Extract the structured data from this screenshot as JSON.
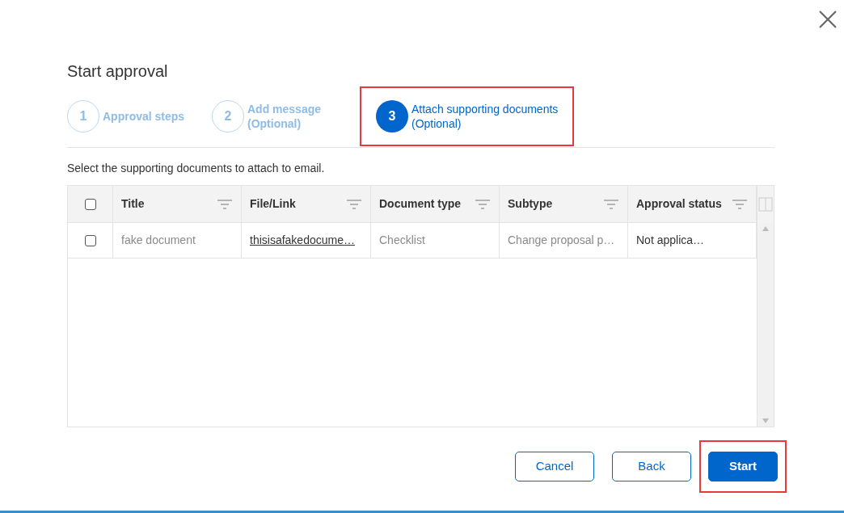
{
  "dialog": {
    "title": "Start approval"
  },
  "steps": [
    {
      "number": "1",
      "label": "Approval steps",
      "selected": false,
      "highlighted": false
    },
    {
      "number": "2",
      "label": "Add message",
      "note": "(Optional)",
      "selected": false,
      "highlighted": false
    },
    {
      "number": "3",
      "label": "Attach supporting documents",
      "note": "(Optional)",
      "selected": true,
      "highlighted": true
    }
  ],
  "instruction": "Select the supporting documents to attach to email.",
  "table": {
    "all_checked": false,
    "columns": [
      "Title",
      "File/Link",
      "Document type",
      "Subtype",
      "Approval status"
    ],
    "rows": [
      {
        "checked": false,
        "cells": [
          {
            "text": "fake document",
            "kind": "muted"
          },
          {
            "text": "thisisafakedocume…",
            "kind": "link"
          },
          {
            "text": "Checklist",
            "kind": "muted"
          },
          {
            "text": "Change proposal p…",
            "kind": "muted"
          },
          {
            "text": "Not applica…",
            "kind": "plain"
          }
        ]
      }
    ]
  },
  "buttons": [
    {
      "label": "Cancel",
      "kind": "outline",
      "highlighted": false
    },
    {
      "label": "Back",
      "kind": "outline",
      "highlighted": false
    },
    {
      "label": "Start",
      "kind": "primary",
      "highlighted": true
    }
  ]
}
